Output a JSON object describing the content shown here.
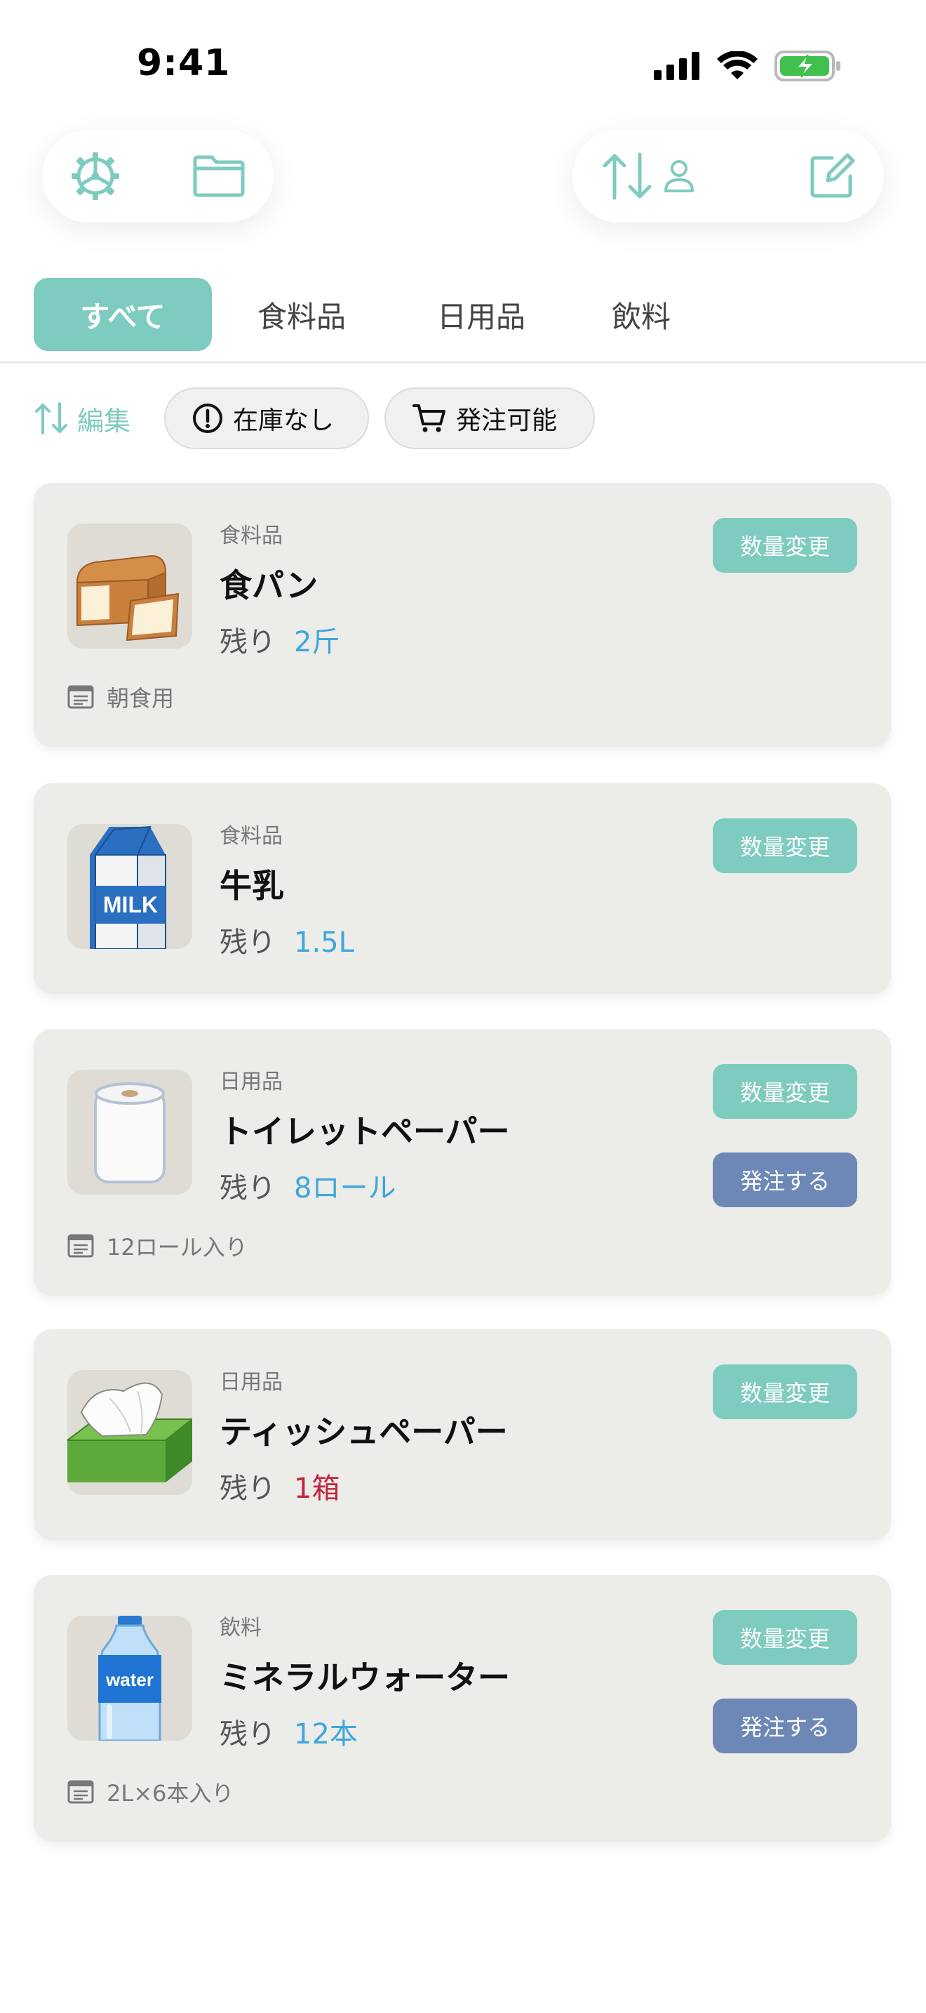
{
  "status": {
    "time": "9:41"
  },
  "tabs": [
    {
      "label": "すべて",
      "active": true
    },
    {
      "label": "食料品",
      "active": false
    },
    {
      "label": "日用品",
      "active": false
    },
    {
      "label": "飲料",
      "active": false
    }
  ],
  "filters": {
    "edit_label": "編集",
    "out_of_stock": "在庫なし",
    "orderable": "発注可能"
  },
  "buttons": {
    "change_qty": "数量変更",
    "order": "発注する"
  },
  "items": [
    {
      "category": "食料品",
      "name": "食パン",
      "remain_label": "残り",
      "quantity": "2斤",
      "low": false,
      "note": "朝食用",
      "orderable": false,
      "image": "bread-icon"
    },
    {
      "category": "食料品",
      "name": "牛乳",
      "remain_label": "残り",
      "quantity": "1.5L",
      "low": false,
      "note": "",
      "orderable": false,
      "image": "milk-icon",
      "image_text": "MILK"
    },
    {
      "category": "日用品",
      "name": "トイレットペーパー",
      "remain_label": "残り",
      "quantity": "8ロール",
      "low": false,
      "note": "12ロール入り",
      "orderable": true,
      "image": "toilet-paper-icon"
    },
    {
      "category": "日用品",
      "name": "ティッシュペーパー",
      "remain_label": "残り",
      "quantity": "1箱",
      "low": true,
      "note": "",
      "orderable": false,
      "image": "tissue-box-icon"
    },
    {
      "category": "飲料",
      "name": "ミネラルウォーター",
      "remain_label": "残り",
      "quantity": "12本",
      "low": false,
      "note": "2L×6本入り",
      "orderable": true,
      "image": "water-bottle-icon",
      "image_text": "water"
    }
  ],
  "colors": {
    "accent": "#7ecbc0",
    "order": "#6d88b6",
    "qty": "#3ea6dc",
    "low": "#c2253f"
  }
}
